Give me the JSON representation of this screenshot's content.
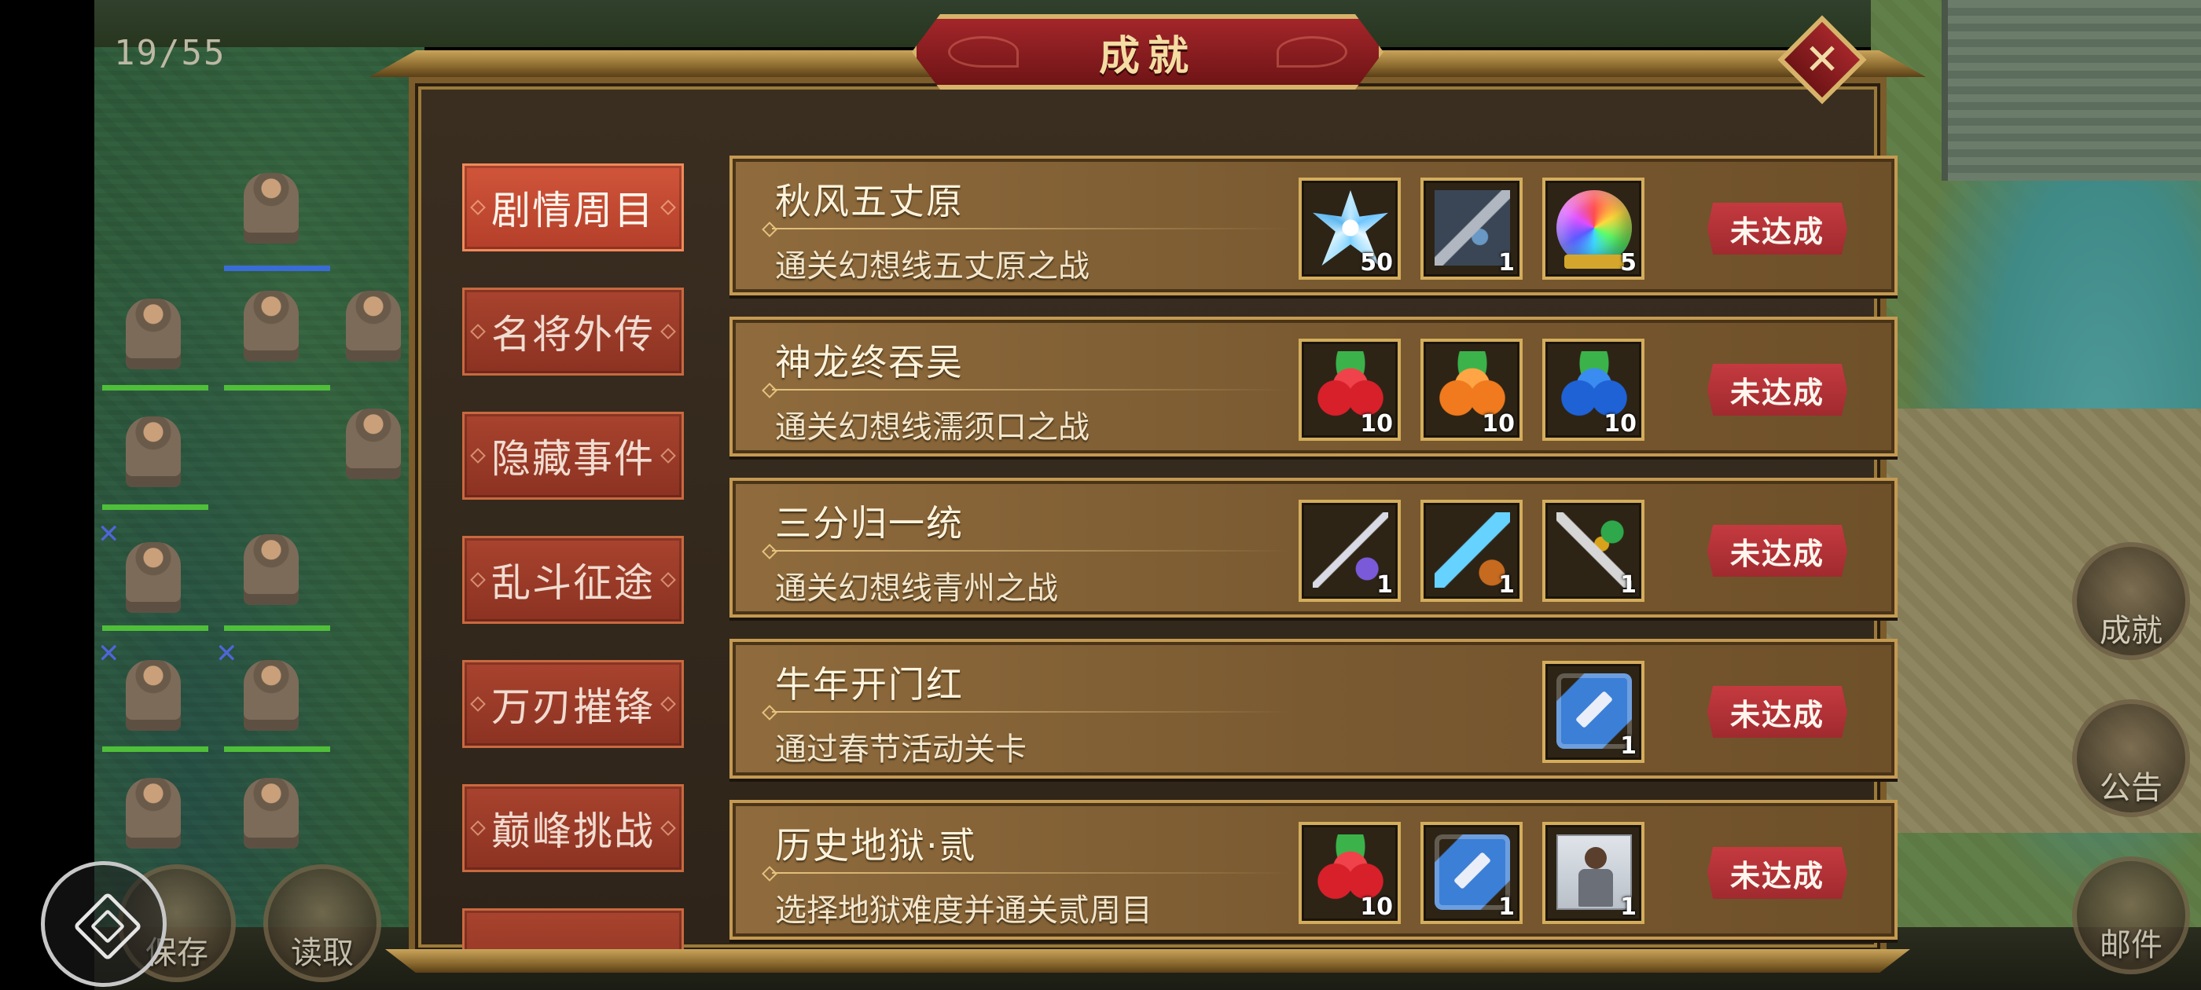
{
  "hud": {
    "turn_counter": "19/55",
    "right_buttons": [
      {
        "label": "成就"
      },
      {
        "label": "公告"
      },
      {
        "label": "邮件"
      }
    ],
    "bottom_buttons": [
      {
        "label": "保存"
      },
      {
        "label": "读取"
      }
    ]
  },
  "dialog": {
    "title": "成就",
    "close_glyph": "✕",
    "tabs": [
      {
        "label": "剧情周目",
        "active": true
      },
      {
        "label": "名将外传",
        "active": false
      },
      {
        "label": "隐藏事件",
        "active": false
      },
      {
        "label": "乱斗征途",
        "active": false
      },
      {
        "label": "万刃摧锋",
        "active": false
      },
      {
        "label": "巅峰挑战",
        "active": false
      }
    ],
    "achievements": [
      {
        "title": "秋风五丈原",
        "desc": "通关幻想线五丈原之战",
        "status": "未达成",
        "rewards": [
          {
            "icon": "ice-crystal-icon",
            "qty": "50"
          },
          {
            "icon": "spear-icon",
            "qty": "1"
          },
          {
            "icon": "rainbow-orb-icon",
            "qty": "5"
          }
        ]
      },
      {
        "title": "神龙终吞吴",
        "desc": "通关幻想线濡须口之战",
        "status": "未达成",
        "rewards": [
          {
            "icon": "red-fruit-icon",
            "qty": "10"
          },
          {
            "icon": "orange-fruit-icon",
            "qty": "10"
          },
          {
            "icon": "blue-fruit-icon",
            "qty": "10"
          }
        ]
      },
      {
        "title": "三分归一统",
        "desc": "通关幻想线青州之战",
        "status": "未达成",
        "rewards": [
          {
            "icon": "halberd-icon",
            "qty": "1"
          },
          {
            "icon": "ice-sword-icon",
            "qty": "1"
          },
          {
            "icon": "jade-sword-icon",
            "qty": "1"
          }
        ]
      },
      {
        "title": "牛年开门红",
        "desc": "通过春节活动关卡",
        "status": "未达成",
        "rewards": [
          {
            "icon": "blue-scroll-icon",
            "qty": "1"
          }
        ]
      },
      {
        "title": "历史地狱·贰",
        "desc": "选择地狱难度并通关贰周目",
        "status": "未达成",
        "rewards": [
          {
            "icon": "red-fruit-icon",
            "qty": "10"
          },
          {
            "icon": "blue-scroll-icon",
            "qty": "1"
          },
          {
            "icon": "general-portrait-icon",
            "qty": "1"
          }
        ]
      }
    ]
  }
}
